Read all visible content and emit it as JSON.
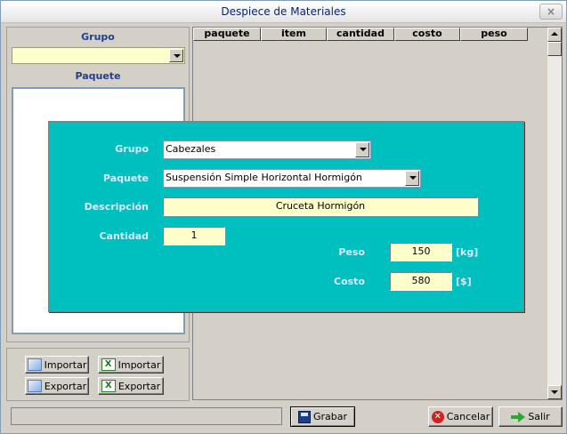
{
  "window": {
    "title": "Despiece de Materiales",
    "close_glyph": "×"
  },
  "left": {
    "grupo_label": "Grupo",
    "grupo_value": "",
    "paquete_label": "Paquete",
    "import_label": "Importar",
    "export_label": "Exportar",
    "excel_import_label": "Importar",
    "excel_export_label": "Exportar"
  },
  "grid": {
    "columns": [
      "paquete",
      "item",
      "cantidad",
      "costo",
      "peso"
    ]
  },
  "dialog": {
    "grupo_label": "Grupo",
    "grupo_value": "Cabezales",
    "paquete_label": "Paquete",
    "paquete_value": "Suspensión Simple Horizontal Hormigón",
    "descripcion_label": "Descripción",
    "descripcion_value": "Cruceta Hormigón",
    "cantidad_label": "Cantidad",
    "cantidad_value": "1",
    "peso_label": "Peso",
    "peso_value": "150",
    "peso_unit": "[kg]",
    "costo_label": "Costo",
    "costo_value": "580",
    "costo_unit": "[$]"
  },
  "footer": {
    "save_label": "Grabar",
    "cancel_label": "Cancelar",
    "exit_label": "Salir"
  },
  "icons": {
    "excel_glyph": "X",
    "cancel_glyph": "✕"
  },
  "colors": {
    "dialog_bg": "#00bfbf",
    "input_bg": "#ffffcc",
    "label_blue": "#1f3f8f"
  }
}
